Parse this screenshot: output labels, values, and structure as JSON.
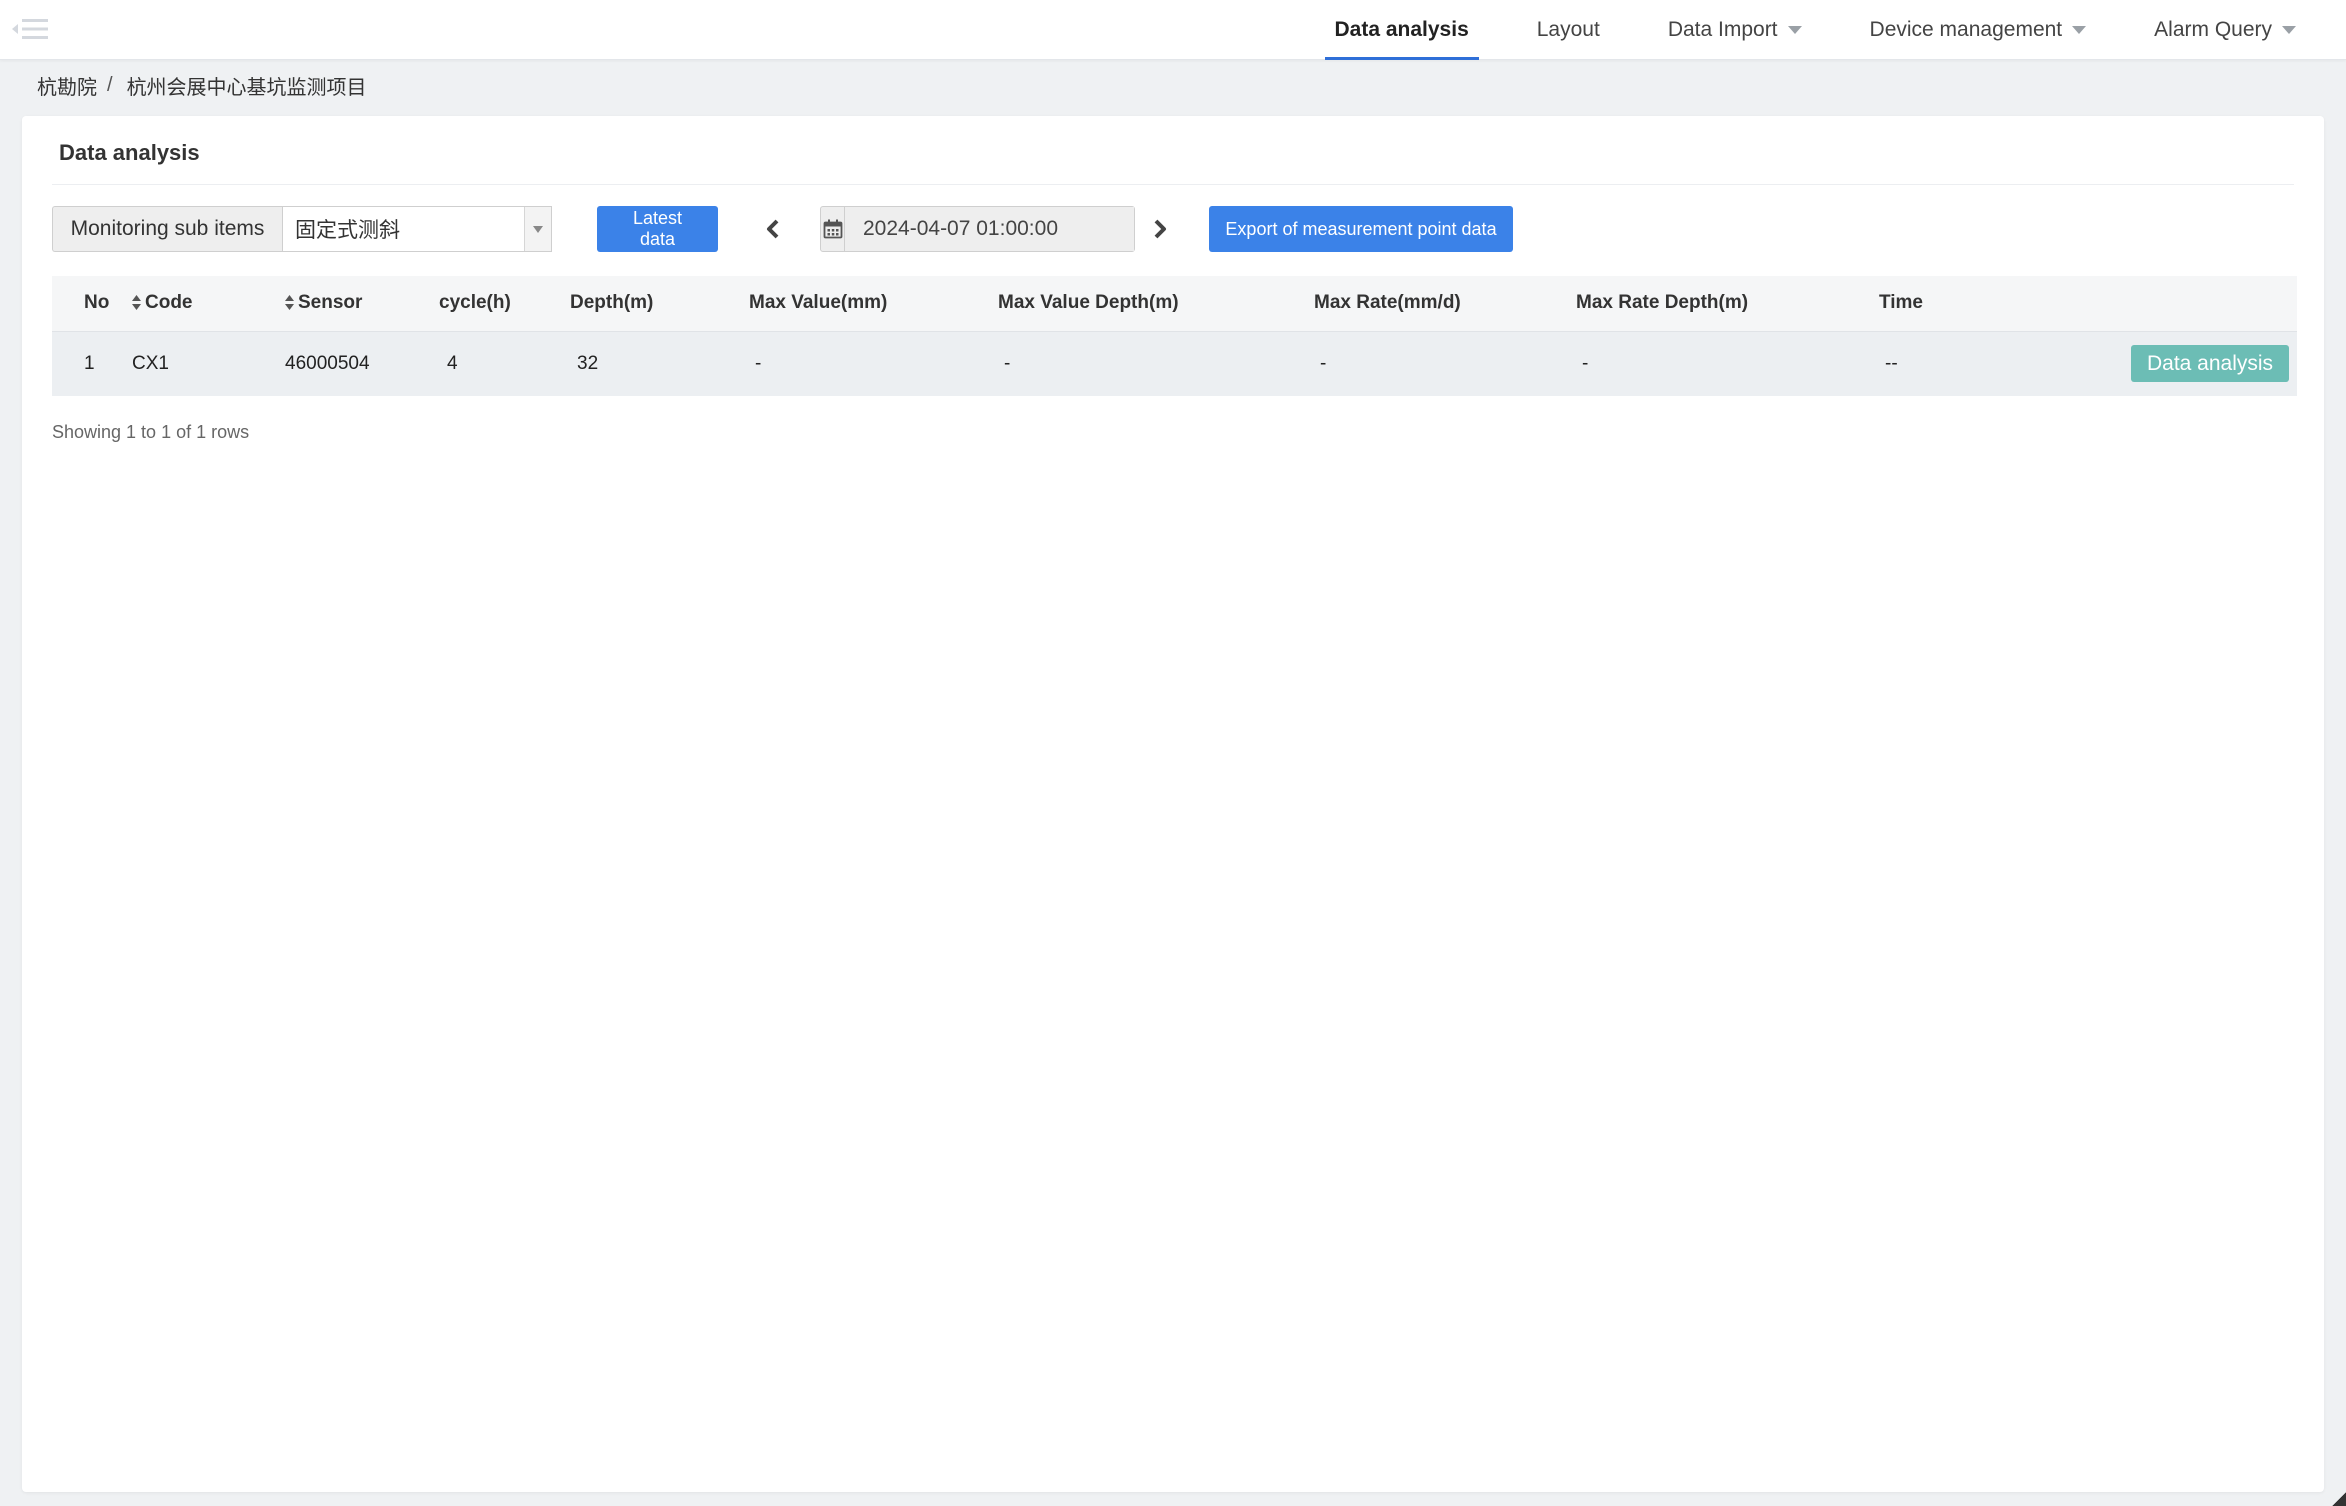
{
  "nav": {
    "items": [
      {
        "label": "Data analysis",
        "active": true,
        "dropdown": false
      },
      {
        "label": "Layout",
        "active": false,
        "dropdown": false
      },
      {
        "label": "Data Import",
        "active": false,
        "dropdown": true
      },
      {
        "label": "Device management",
        "active": false,
        "dropdown": true
      },
      {
        "label": "Alarm Query",
        "active": false,
        "dropdown": true
      }
    ],
    "accent_color": "#2f6fd8"
  },
  "breadcrumb": {
    "root": "杭勘院",
    "separator": "/",
    "current": "杭州会展中心基坑监测项目"
  },
  "card": {
    "title": "Data analysis"
  },
  "toolbar": {
    "sub_items_label": "Monitoring sub items",
    "sub_items_value": "固定式测斜",
    "latest_label": "Latest data",
    "date_value": "2024-04-07 01:00:00",
    "export_label": "Export of measurement point data",
    "primary_color": "#3b82e8"
  },
  "table": {
    "columns": [
      "No",
      "Code",
      "Sensor",
      "cycle(h)",
      "Depth(m)",
      "Max Value(mm)",
      "Max Value Depth(m)",
      "Max Rate(mm/d)",
      "Max Rate Depth(m)",
      "Time"
    ],
    "rows": [
      {
        "cells": [
          "1",
          "CX1",
          "46000504",
          "4",
          "32",
          "-",
          "-",
          "-",
          "-",
          "--"
        ],
        "action_label": "Data analysis"
      }
    ],
    "action_color": "#6cbdb5"
  },
  "pagination": {
    "summary": "Showing 1 to 1 of 1 rows"
  },
  "icons": {
    "menu": "menu-collapse-icon",
    "sort": "sort-icon",
    "calendar": "calendar-icon",
    "prev": "chevron-left-icon",
    "next": "chevron-right-icon",
    "dropdown": "caret-down-icon"
  }
}
